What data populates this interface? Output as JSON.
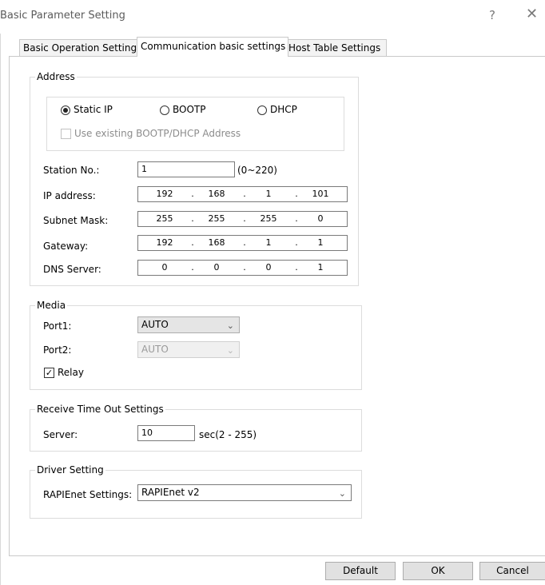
{
  "window": {
    "title": "Basic Parameter Setting",
    "help_glyph": "?",
    "close_glyph": "✕"
  },
  "tabs": [
    {
      "label": "Basic Operation Settings",
      "active": false
    },
    {
      "label": "Communication basic settings",
      "active": true
    },
    {
      "label": "Host Table Settings",
      "active": false
    }
  ],
  "address": {
    "title": "Address",
    "radios": [
      {
        "label": "Static IP",
        "selected": true
      },
      {
        "label": "BOOTP",
        "selected": false
      },
      {
        "label": "DHCP",
        "selected": false
      }
    ],
    "use_existing_label": "Use existing BOOTP/DHCP Address",
    "station_label": "Station No.:",
    "station_value": "1",
    "station_range": "(0~220)",
    "ip_label": "IP address:",
    "ip": [
      "192",
      "168",
      "1",
      "101"
    ],
    "subnet_label": "Subnet Mask:",
    "subnet": [
      "255",
      "255",
      "255",
      "0"
    ],
    "gateway_label": "Gateway:",
    "gateway": [
      "192",
      "168",
      "1",
      "1"
    ],
    "dns_label": "DNS Server:",
    "dns": [
      "0",
      "0",
      "0",
      "1"
    ],
    "dot": "."
  },
  "media": {
    "title": "Media",
    "port1_label": "Port1:",
    "port1_value": "AUTO",
    "port2_label": "Port2:",
    "port2_value": "AUTO",
    "relay_label": "Relay",
    "relay_checked": true
  },
  "timeout": {
    "title": "Receive Time Out Settings",
    "server_label": "Server:",
    "server_value": "10",
    "server_unit": "sec(2 - 255)"
  },
  "driver": {
    "title": "Driver Setting",
    "rapi_label": "RAPIEnet Settings:",
    "rapi_value": "RAPIEnet v2"
  },
  "buttons": {
    "default": "Default",
    "ok": "OK",
    "cancel": "Cancel"
  },
  "icons": {
    "chevron": "chevron-down-icon",
    "check": "checkmark-icon"
  }
}
